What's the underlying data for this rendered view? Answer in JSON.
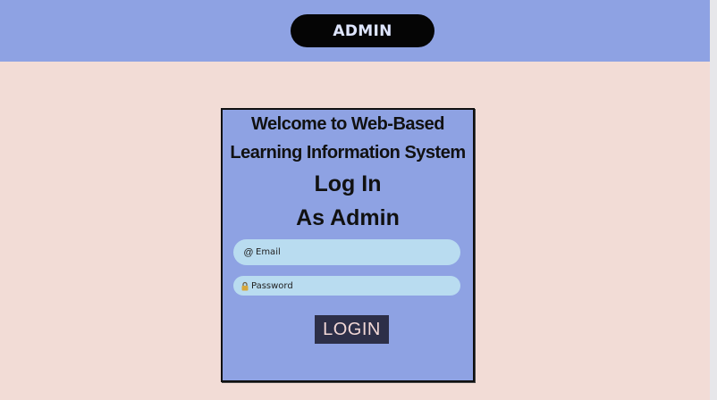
{
  "header": {
    "admin_label": "ADMIN"
  },
  "login_card": {
    "welcome_line_1": "Welcome to Web-Based",
    "welcome_line_2": "Learning Information System",
    "heading_line_1": "Log In",
    "heading_line_2": "As Admin",
    "email": {
      "icon": "at-sign-icon",
      "placeholder": "Email",
      "value": ""
    },
    "password": {
      "icon": "lock-icon",
      "placeholder": "Password",
      "value": ""
    },
    "login_label": "LOGIN"
  },
  "colors": {
    "header_bg": "#8ea2e3",
    "page_bg": "#f2dcd6",
    "card_bg": "#8ea2e3",
    "input_bg": "#b9dcf0",
    "admin_pill_bg": "#050505",
    "button_bg": "#2d2f48"
  }
}
